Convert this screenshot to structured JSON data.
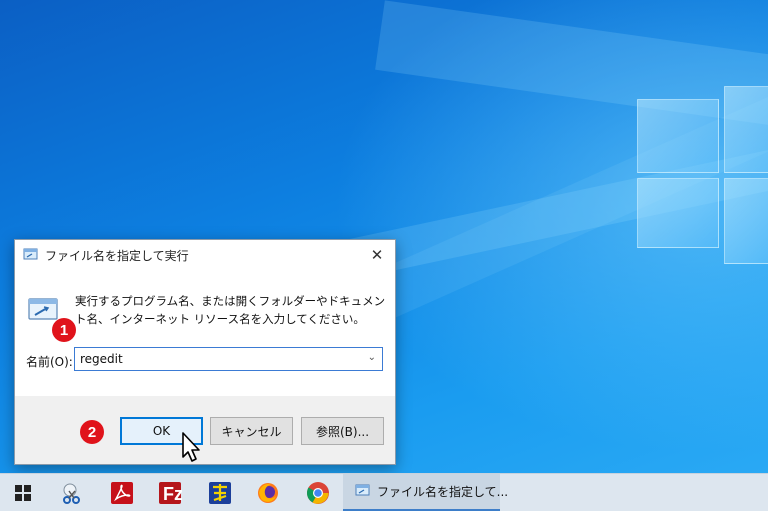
{
  "dialog": {
    "title": "ファイル名を指定して実行",
    "close_glyph": "✕",
    "description": "実行するプログラム名、または開くフォルダーやドキュメント名、インターネット リソース名を入力してください。",
    "name_label": "名前(O):",
    "name_value": "regedit",
    "ok_label": "OK",
    "cancel_label": "キャンセル",
    "browse_label": "参照(B)..."
  },
  "annotations": {
    "step1": "1",
    "step2": "2"
  },
  "taskbar": {
    "icons": [
      "windows-start-icon",
      "snipping-tool-icon",
      "acrobat-icon",
      "filezilla-icon",
      "hidemaru-editor-icon",
      "firefox-icon",
      "chrome-icon"
    ],
    "active_window_label": "ファイル名を指定して..."
  },
  "colors": {
    "accent": "#0078d7",
    "annotation_red": "#e0131b",
    "desktop_blue": "#0d7fe0"
  }
}
